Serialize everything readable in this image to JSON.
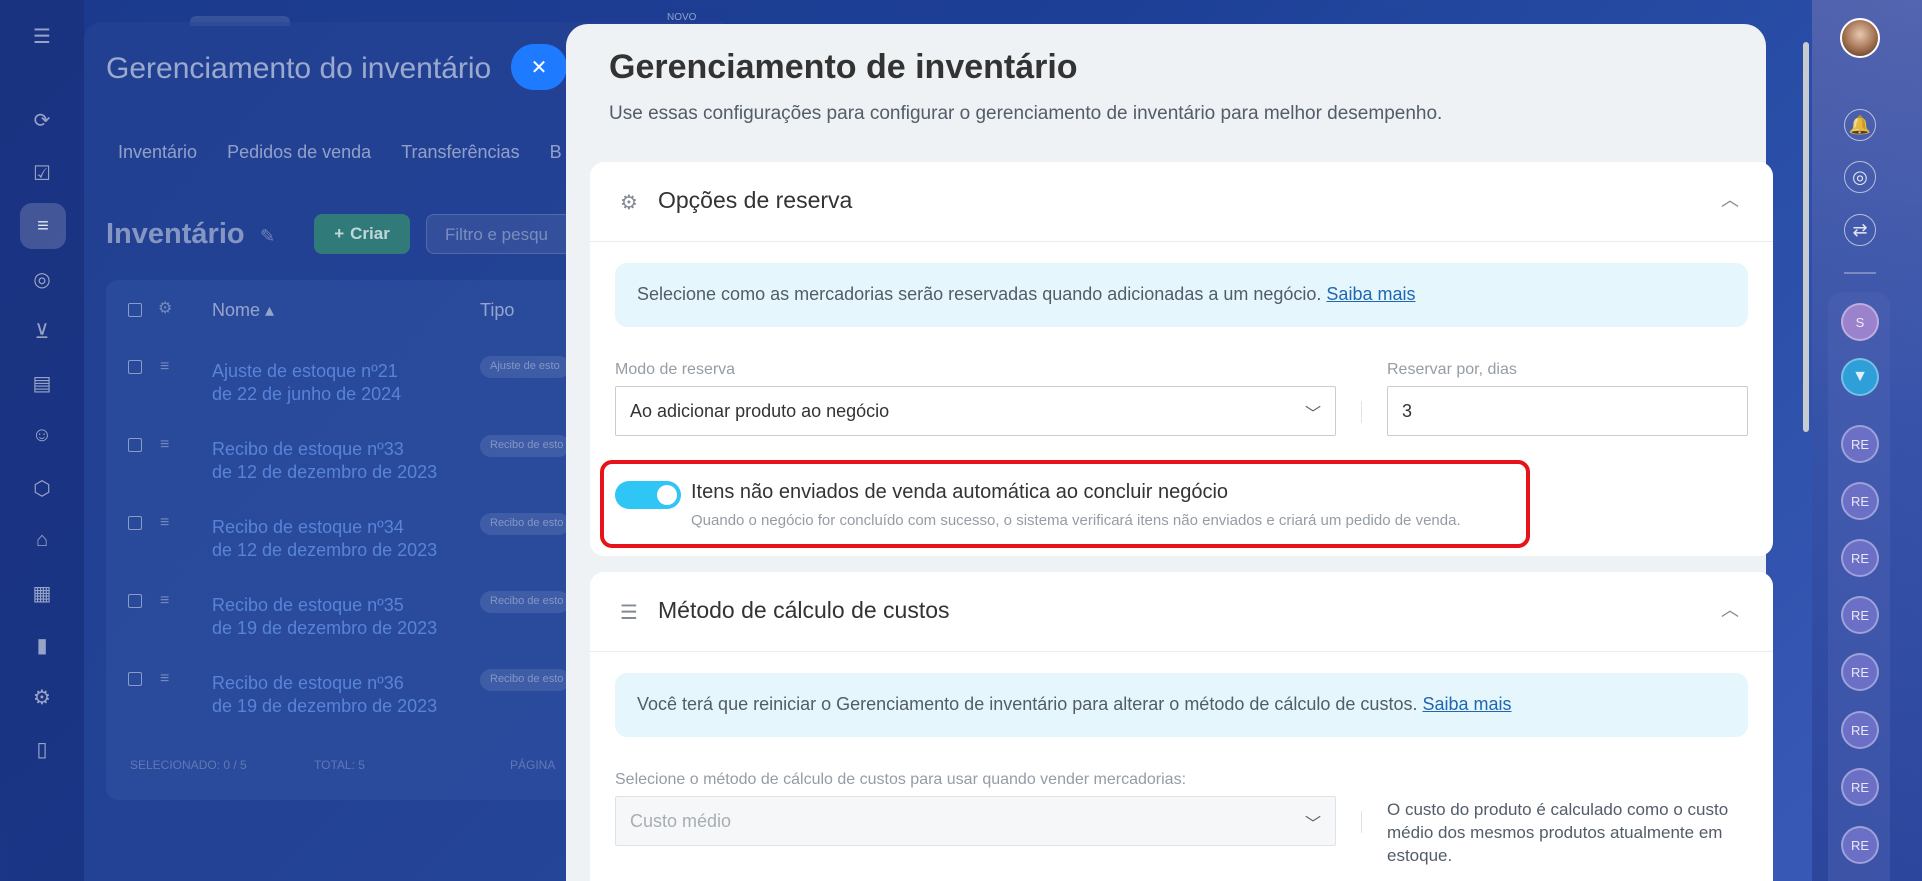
{
  "background_app": {
    "novo_label": "NOVO",
    "title": "Gerenciamento do inventário",
    "close_icon": "close-icon",
    "tabs": [
      "Inventário",
      "Pedidos de venda",
      "Transferências",
      "B"
    ],
    "heading": "Inventário",
    "create_button": "Criar",
    "search_placeholder": "Filtro e pesqu",
    "table_headers": {
      "name": "Nome ▴",
      "type": "Tipo"
    },
    "rows": [
      {
        "title": "Ajuste de estoque nº21",
        "date": "de 22 de junho de 2024",
        "type": "Ajuste de esto"
      },
      {
        "title": "Recibo de estoque nº33",
        "date": "de 12 de dezembro de 2023",
        "type": "Recibo de esto"
      },
      {
        "title": "Recibo de estoque nº34",
        "date": "de 12 de dezembro de 2023",
        "type": "Recibo de esto"
      },
      {
        "title": "Recibo de estoque nº35",
        "date": "de 19 de dezembro de 2023",
        "type": "Recibo de esto"
      },
      {
        "title": "Recibo de estoque nº36",
        "date": "de 19 de dezembro de 2023",
        "type": "Recibo de esto"
      }
    ],
    "footer": {
      "selected": "SELECIONADO: 0 / 5",
      "total": "TOTAL: 5",
      "pages": "PÁGINA"
    }
  },
  "slider": {
    "title": "Gerenciamento de inventário",
    "subtitle": "Use essas configurações para configurar o gerenciamento de inventário para melhor desempenho.",
    "reserve_card": {
      "title": "Opções de reserva",
      "info": "Selecione como as mercadorias serão reservadas quando adicionadas a um negócio.",
      "info_link": "Saiba mais",
      "mode_label": "Modo de reserva",
      "mode_value": "Ao adicionar produto ao negócio",
      "days_label": "Reservar por, dias",
      "days_value": "3",
      "toggle_on": true,
      "auto_title": "Itens não enviados de venda automática ao concluir negócio",
      "auto_desc": "Quando o negócio for concluído com sucesso, o sistema verificará itens não enviados e criará um pedido de venda."
    },
    "cost_card": {
      "title": "Método de cálculo de custos",
      "info": "Você terá que reiniciar o Gerenciamento de inventário para alterar o método de cálculo de custos.",
      "info_link": "Saiba mais",
      "method_label": "Selecione o método de cálculo de custos para usar quando vender mercadorias:",
      "method_value": "Custo médio",
      "method_desc": "O custo do produto é calculado como o custo médio dos mesmos produtos atualmente em estoque."
    }
  },
  "right_bar": {
    "avatars": [
      "S",
      "",
      "RE",
      "RE",
      "RE",
      "RE",
      "RE",
      "RE",
      "RE",
      "RE"
    ]
  },
  "colors": {
    "accent": "#2fc6f6",
    "highlight": "#e8131a",
    "link": "#2067b0",
    "close_button": "#1e7bff"
  }
}
